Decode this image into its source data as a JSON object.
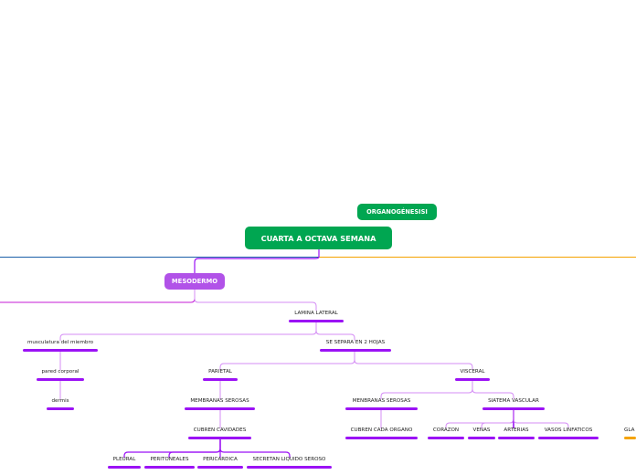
{
  "colors": {
    "main_node": "#00a651",
    "secondary_node": "#b152e8",
    "branch_purple": "#9b12f5",
    "branch_light": "#d48cf5",
    "branch_blue": "#1b5fa8",
    "branch_orange": "#f5a300",
    "branch_magenta": "#c41bd6"
  },
  "nodes": {
    "organogenesis": "ORGANOGÉNESISI",
    "main": "CUARTA A OCTAVA SEMANA",
    "mesodermo": "MESODERMO",
    "lamina_lateral": "LAMINA LATERAL",
    "musculatura": "musculatura del miembro",
    "pared_corporal": "pared corporal",
    "dermis": "dermis",
    "se_separa": "SE SEPARA EN 2 HOJAS",
    "parietal": "PARIETAL",
    "membranas_serosas": "MEMBRANAS SEROSAS",
    "cubren_cavidades": "CUBREN CAVIDADES",
    "pleural": "PLEURAL",
    "peritoneales": "PERITONEALES",
    "pericardica": "PERICARDICA",
    "secretan": "SECRETAN LIQUIDO SEROSO",
    "visceral": "VISCERAL",
    "menbranas_serosas": "MENBRANAS SEROSAS",
    "cubren_cada_organo": "CUBREN CADA ORGANO",
    "sistema_vascular": "SIATEMA VASCULAR",
    "corazon": "CORAZON",
    "venas": "VENAS",
    "arterias": "ARTERIAS",
    "vasos_linfaticos": "VASOS LINFATICOS",
    "cut_off": "GLA"
  }
}
